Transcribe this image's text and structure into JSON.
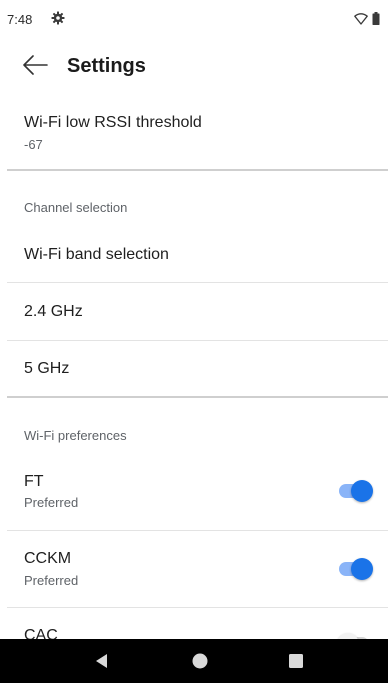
{
  "status_bar": {
    "time": "7:48",
    "icons": [
      "gear-icon",
      "wifi-icon",
      "battery-icon"
    ]
  },
  "app_bar": {
    "title": "Settings",
    "back_icon": "arrow-back-icon"
  },
  "rssi": {
    "title": "Wi-Fi low RSSI threshold",
    "value": "-67"
  },
  "channel_selection": {
    "category": "Channel selection",
    "band_selection": "Wi-Fi band selection",
    "band_24": "2.4 GHz",
    "band_5": "5 GHz"
  },
  "wifi_preferences": {
    "category": "Wi-Fi preferences",
    "items": [
      {
        "title": "FT",
        "summary": "Preferred",
        "enabled": true
      },
      {
        "title": "CCKM",
        "summary": "Preferred",
        "enabled": true
      },
      {
        "title": "CAC",
        "summary": "",
        "enabled": false
      }
    ]
  },
  "nav_bar": {
    "buttons": [
      "back-triangle-icon",
      "home-circle-icon",
      "recents-square-icon"
    ]
  },
  "colors": {
    "accent": "#1a73e8",
    "accent_track": "#8ab4f8",
    "secondary_text": "#5f6368",
    "nav_bar": "#000000"
  }
}
